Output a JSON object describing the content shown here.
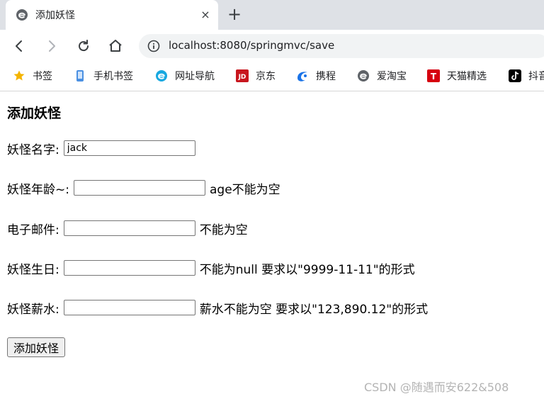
{
  "browser": {
    "tab": {
      "title": "添加妖怪",
      "close_icon": "×",
      "new_tab_icon": "+"
    },
    "address_bar": {
      "url": "localhost:8080/springmvc/save"
    },
    "bookmarks": [
      {
        "label": "书签",
        "icon": "star-icon",
        "color": "#f4b400"
      },
      {
        "label": "手机书签",
        "icon": "phone-icon",
        "color": "#4a90e2"
      },
      {
        "label": "网址导航",
        "icon": "e-globe-icon",
        "color": "#18a8e0"
      },
      {
        "label": "京东",
        "icon": "jd-icon",
        "color": "#c8161e",
        "icon_text": "JD"
      },
      {
        "label": "携程",
        "icon": "ctrip-icon",
        "color": "#1a73e8"
      },
      {
        "label": "爱淘宝",
        "icon": "e-globe-icon",
        "color": "#5f6368"
      },
      {
        "label": "天猫精选",
        "icon": "tmall-icon",
        "color": "#d6000f",
        "icon_text": "T"
      },
      {
        "label": "抖音",
        "icon": "tiktok-icon",
        "color": "#000000"
      }
    ]
  },
  "page": {
    "title": "添加妖怪",
    "form": {
      "name": {
        "label": "妖怪名字:",
        "value": "jack"
      },
      "age": {
        "label": "妖怪年龄~:",
        "value": "",
        "error": "age不能为空"
      },
      "email": {
        "label": "电子邮件:",
        "value": "",
        "error": "不能为空"
      },
      "birthday": {
        "label": "妖怪生日:",
        "value": "",
        "error": "不能为null 要求以\"9999-11-11\"的形式"
      },
      "salary": {
        "label": "妖怪薪水:",
        "value": "",
        "error": "薪水不能为空 要求以\"123,890.12\"的形式"
      },
      "submit_label": "添加妖怪"
    }
  },
  "watermark": "CSDN @随遇而安622&508"
}
